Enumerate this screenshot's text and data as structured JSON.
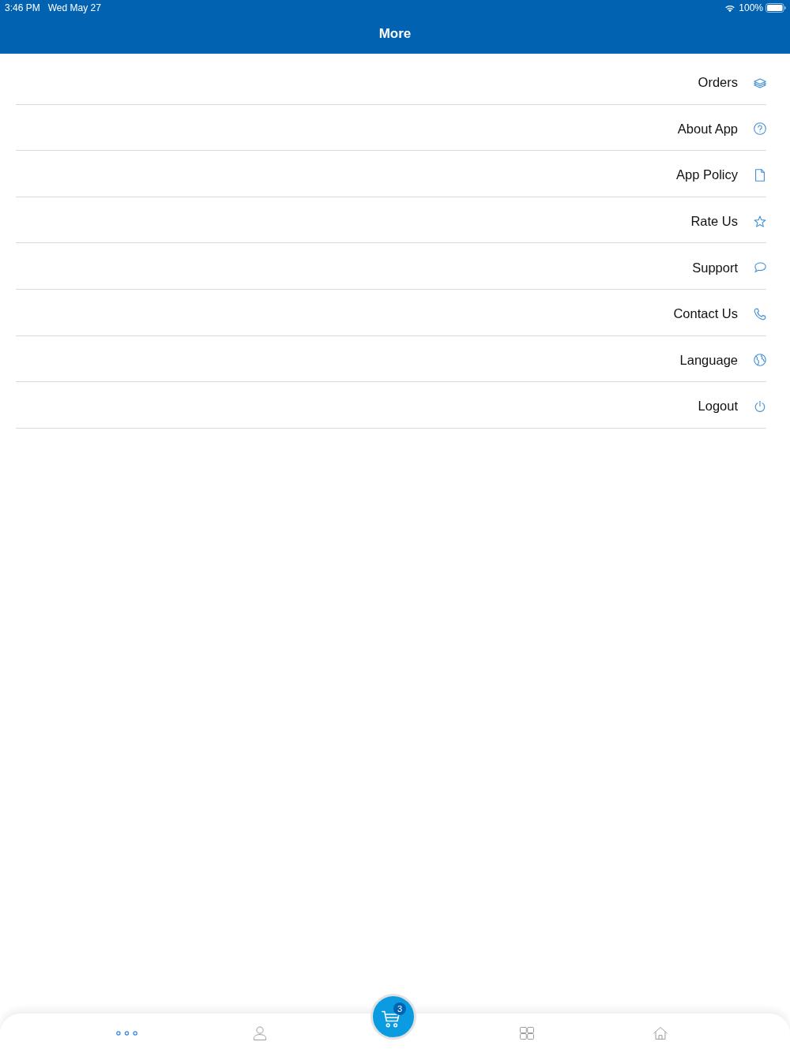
{
  "status_bar": {
    "time": "3:46 PM",
    "date": "Wed May 27",
    "battery": "100%"
  },
  "header": {
    "title": "More"
  },
  "menu": {
    "items": [
      {
        "label": "Orders",
        "kind": "orders"
      },
      {
        "label": "About App",
        "kind": "about"
      },
      {
        "label": "App Policy",
        "kind": "policy"
      },
      {
        "label": "Rate Us",
        "kind": "rate"
      },
      {
        "label": "Support",
        "kind": "support"
      },
      {
        "label": "Contact Us",
        "kind": "contact"
      },
      {
        "label": "Language",
        "kind": "language"
      },
      {
        "label": "Logout",
        "kind": "logout"
      }
    ]
  },
  "tab_bar": {
    "tabs": [
      {
        "kind": "more",
        "selected": true
      },
      {
        "kind": "profile",
        "selected": false
      },
      {
        "kind": "cart",
        "selected": false,
        "badge": "3"
      },
      {
        "kind": "categories",
        "selected": false
      },
      {
        "kind": "home",
        "selected": false
      }
    ]
  }
}
